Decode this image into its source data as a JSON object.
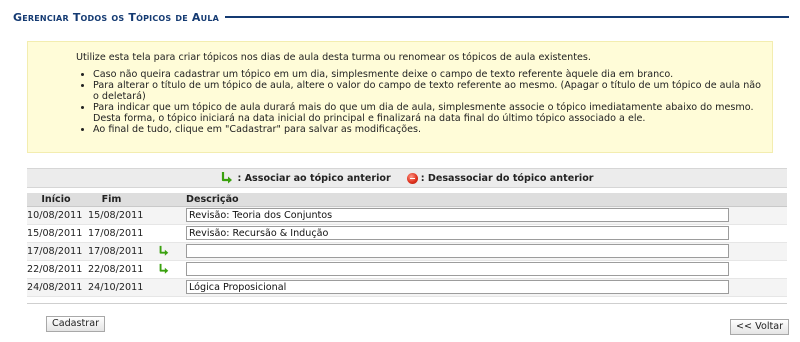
{
  "page": {
    "title": "Gerenciar Todos os Tópicos de Aula"
  },
  "info": {
    "intro": "Utilize esta tela para criar tópicos nos dias de aula desta turma ou renomear os tópicos de aula existentes.",
    "bullets": [
      "Caso não queira cadastrar um tópico em um dia, simplesmente deixe o campo de texto referente àquele dia em branco.",
      "Para alterar o título de um tópico de aula, altere o valor do campo de texto referente ao mesmo. (Apagar o título de um tópico de aula não o deletará)",
      "Para indicar que um tópico de aula durará mais do que um dia de aula, simplesmente associe o tópico imediatamente abaixo do mesmo. Desta forma, o tópico iniciará na data inicial do principal e finalizará na data final do último tópico associado a ele.",
      "Ao final de tudo, clique em \"Cadastrar\" para salvar as modificações."
    ]
  },
  "legend": {
    "associate_icon": "green-arrow-icon",
    "associate_label": ": Associar ao tópico anterior",
    "disassociate_icon": "red-circle-minus-icon",
    "disassociate_label": ": Desassociar do tópico anterior"
  },
  "table": {
    "headers": {
      "inicio": "Início",
      "fim": "Fim",
      "descricao": "Descrição"
    },
    "rows": [
      {
        "inicio": "10/08/2011",
        "fim": "15/08/2011",
        "descricao": "Revisão: Teoria dos Conjuntos",
        "associated": false
      },
      {
        "inicio": "15/08/2011",
        "fim": "17/08/2011",
        "descricao": "Revisão: Recursão & Indução",
        "associated": false
      },
      {
        "inicio": "17/08/2011",
        "fim": "17/08/2011",
        "descricao": "",
        "associated": true
      },
      {
        "inicio": "22/08/2011",
        "fim": "22/08/2011",
        "descricao": "",
        "associated": true
      },
      {
        "inicio": "24/08/2011",
        "fim": "24/10/2011",
        "descricao": "Lógica Proposicional",
        "associated": false
      }
    ]
  },
  "buttons": {
    "submit_label": "Cadastrar",
    "back_label": "<< Voltar"
  },
  "colors": {
    "title": "#143a72",
    "info_background": "#fffcd8",
    "associate_arrow": "#3aa10f",
    "disassociate_circle": "#e0331f"
  }
}
